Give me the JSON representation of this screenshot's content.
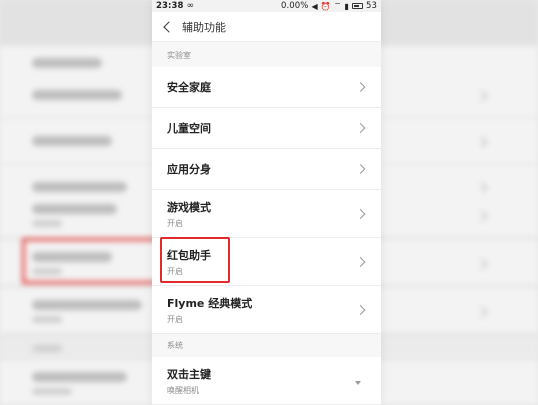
{
  "status_bar": {
    "time": "23:38",
    "loop_icon": "∞",
    "network_speed": "0.00%",
    "battery_level": "53"
  },
  "header": {
    "title": "辅助功能"
  },
  "sections": [
    {
      "label": "实验室",
      "items": [
        {
          "title": "安全家庭",
          "subtitle": ""
        },
        {
          "title": "儿童空间",
          "subtitle": ""
        },
        {
          "title": "应用分身",
          "subtitle": ""
        },
        {
          "title": "游戏模式",
          "subtitle": "开启"
        },
        {
          "title": "红包助手",
          "subtitle": "开启"
        },
        {
          "title": "Flyme 经典模式",
          "subtitle": "开启"
        }
      ]
    },
    {
      "label": "系统",
      "items": [
        {
          "title": "双击主键",
          "subtitle": "唤醒相机"
        }
      ]
    }
  ],
  "colors": {
    "highlight": "#e12b2b",
    "section_label": "#8c8c8c",
    "background": "#f7f7f7"
  }
}
